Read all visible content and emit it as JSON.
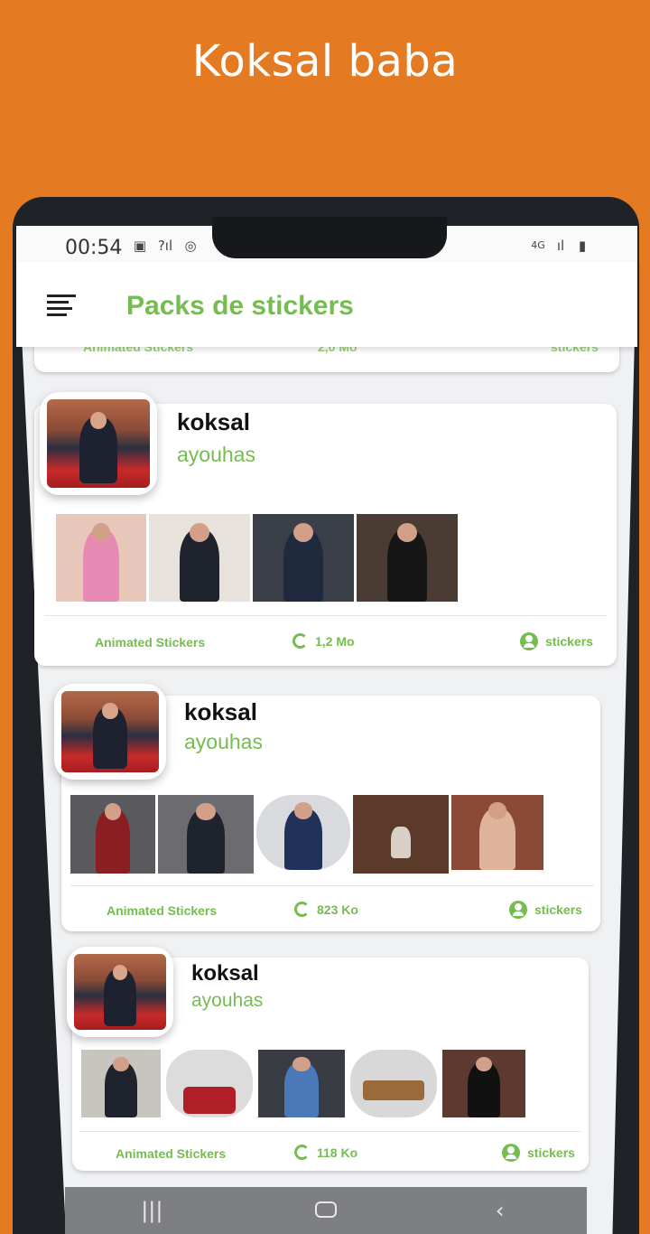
{
  "promo": {
    "title": "Koksal baba"
  },
  "status_bar": {
    "time": "00:54",
    "network": "4G"
  },
  "app_bar": {
    "title": "Packs de stickers"
  },
  "top_partial_card": {
    "type": "Animated Stickers",
    "size": "2,0 Mo",
    "label": "stickers"
  },
  "packs": [
    {
      "name": "koksal",
      "author": "ayouhas",
      "type": "Animated Stickers",
      "size": "1,2 Mo",
      "label": "stickers",
      "sticker_count_shown": 4
    },
    {
      "name": "koksal",
      "author": "ayouhas",
      "type": "Animated Stickers",
      "size": "823 Ko",
      "label": "stickers",
      "sticker_count_shown": 5
    },
    {
      "name": "koksal",
      "author": "ayouhas",
      "type": "Animated Stickers",
      "size": "118 Ko",
      "label": "stickers",
      "sticker_count_shown": 5
    }
  ],
  "colors": {
    "accent": "#74bd4e",
    "background": "#e47a22"
  },
  "icons": {
    "menu": "menu-icon",
    "size": "ring-icon",
    "user": "user-icon"
  }
}
